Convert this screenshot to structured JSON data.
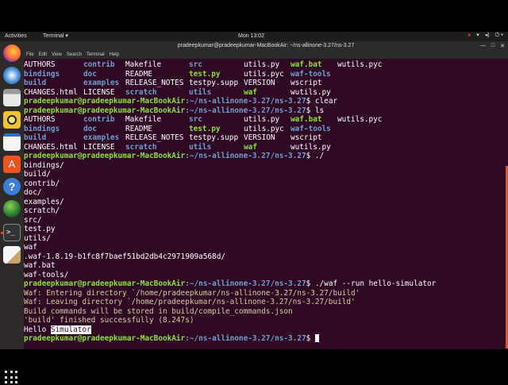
{
  "topbar": {
    "activities": "Activities",
    "app_menu": "Terminal ▾",
    "clock": "Mon 13:02",
    "tray_icons": [
      "record-icon",
      "network-icon",
      "volume-icon",
      "power-icon"
    ]
  },
  "window": {
    "title": "pradeepkumar@pradeepkumar-MacBookAir: ~/ns-allinone-3.27/ns-3.27",
    "menus": [
      "File",
      "Edit",
      "View",
      "Search",
      "Terminal",
      "Help"
    ]
  },
  "dock": {
    "apps": [
      "firefox-icon",
      "thunderbird-icon",
      "files-icon",
      "rhythmbox-icon",
      "writer-icon",
      "software-center-icon",
      "help-icon",
      "updates-icon",
      "terminal-icon",
      "text-editor-icon"
    ]
  },
  "colors": {
    "terminal_bg": "#300a24",
    "dir": "#729fcf",
    "exe": "#8ae234",
    "scrollbar": "#d85a2b",
    "dock_bg": "#2e2a29"
  },
  "terminal": {
    "prompt_user": "pradeepkumar@pradeepkumar-MacBookAir",
    "prompt_path": ":~/ns-allinone-3.27/ns-3.27",
    "commands": {
      "clear": "$ clear",
      "ls": "$ ls",
      "run_dir": "$ ./",
      "run_sim": "$ ./waf --run hello-simulator",
      "final": "$ "
    },
    "ls_rows": [
      [
        "AUTHORS",
        "contrib",
        "Makefile",
        "src",
        "utils.py",
        "waf.bat",
        "wutils.pyc"
      ],
      [
        "bindings",
        "doc",
        "README",
        "test.py",
        "utils.pyc",
        "waf-tools",
        ""
      ],
      [
        "build",
        "examples",
        "RELEASE_NOTES",
        "testpy.supp",
        "VERSION",
        "wscript",
        ""
      ],
      [
        "CHANGES.html",
        "LICENSE",
        "scratch",
        "utils",
        "waf",
        "wutils.py",
        ""
      ]
    ],
    "completions": [
      "bindings/",
      "build/",
      "contrib/",
      "doc/",
      "examples/",
      "scratch/",
      "src/",
      "test.py",
      "utils/",
      "waf",
      ".waf-1.8.19-b1fc8f7baef51bd2db4c2971909a568d/",
      "waf.bat",
      "waf-tools/"
    ],
    "waf_output": [
      "Waf: Entering directory `/home/pradeepkumar/ns-allinone-3.27/ns-3.27/build'",
      "Waf: Leaving directory `/home/pradeepkumar/ns-allinone-3.27/ns-3.27/build'",
      "Build commands will be stored in build/compile_commands.json",
      "'build' finished successfully (8.247s)"
    ],
    "hello_word": "Hello",
    "hello_selected": "Simulator"
  }
}
